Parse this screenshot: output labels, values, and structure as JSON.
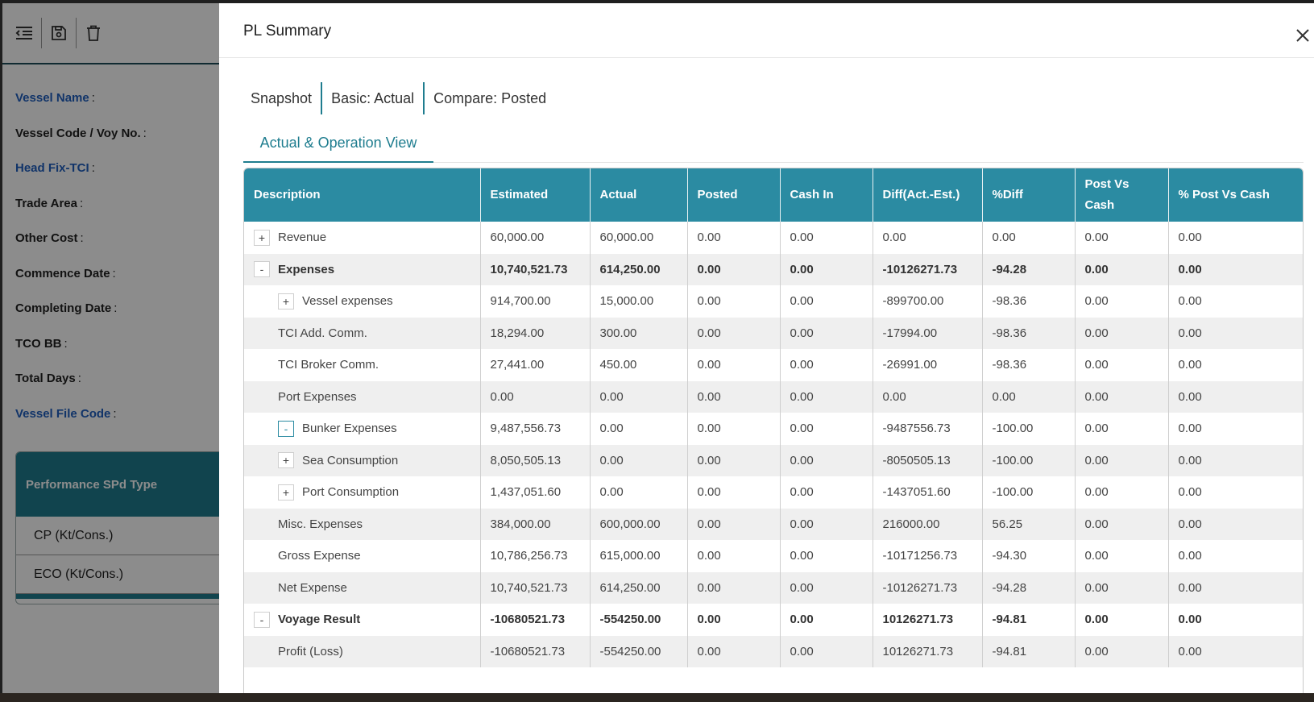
{
  "background": {
    "toolbar": {
      "icons": [
        "outdent-icon",
        "save-icon",
        "trash-icon"
      ]
    },
    "fields": [
      {
        "label": "Vessel Name",
        "highlight": true
      },
      {
        "label": "Vessel Code / Voy No.",
        "highlight": false
      },
      {
        "label": "Head Fix-TCI",
        "highlight": true
      },
      {
        "label": "Trade Area",
        "highlight": false
      },
      {
        "label": "Other Cost",
        "highlight": false
      },
      {
        "label": "Commence Date",
        "highlight": false
      },
      {
        "label": "Completing Date",
        "highlight": false
      },
      {
        "label": "TCO BB",
        "highlight": false
      },
      {
        "label": "Total Days",
        "highlight": false
      },
      {
        "label": "Vessel File Code",
        "highlight": true
      }
    ],
    "colon": ":",
    "performance": {
      "header": "Performance SPd Type",
      "rows": [
        "CP (Kt/Cons.)",
        "ECO (Kt/Cons.)"
      ]
    }
  },
  "drawer": {
    "title": "PL Summary",
    "close_icon": "close-icon",
    "snapshot_items": [
      "Snapshot",
      "Basic: Actual",
      "Compare: Posted"
    ],
    "tabs": [
      {
        "label": "Actual & Operation View",
        "active": true
      }
    ],
    "table": {
      "columns": [
        "Description",
        "Estimated",
        "Actual",
        "Posted",
        "Cash In",
        "Diff(Act.-Est.)",
        "%Diff",
        "Post Vs Cash",
        "% Post Vs Cash"
      ],
      "rows": [
        {
          "level": 0,
          "toggle": "+",
          "bold": false,
          "cells": [
            "Revenue",
            "60,000.00",
            "60,000.00",
            "0.00",
            "0.00",
            "0.00",
            "0.00",
            "0.00",
            "0.00"
          ]
        },
        {
          "level": 0,
          "toggle": "-",
          "bold": true,
          "cells": [
            "Expenses",
            "10,740,521.73",
            "614,250.00",
            "0.00",
            "0.00",
            "-10126271.73",
            "-94.28",
            "0.00",
            "0.00"
          ]
        },
        {
          "level": 1,
          "toggle": "+",
          "bold": false,
          "cells": [
            "Vessel expenses",
            "914,700.00",
            "15,000.00",
            "0.00",
            "0.00",
            "-899700.00",
            "-98.36",
            "0.00",
            "0.00"
          ]
        },
        {
          "level": 1,
          "toggle": "",
          "bold": false,
          "cells": [
            "TCI Add. Comm.",
            "18,294.00",
            "300.00",
            "0.00",
            "0.00",
            "-17994.00",
            "-98.36",
            "0.00",
            "0.00"
          ]
        },
        {
          "level": 1,
          "toggle": "",
          "bold": false,
          "cells": [
            "TCI Broker Comm.",
            "27,441.00",
            "450.00",
            "0.00",
            "0.00",
            "-26991.00",
            "-98.36",
            "0.00",
            "0.00"
          ]
        },
        {
          "level": 1,
          "toggle": "",
          "bold": false,
          "cells": [
            "Port Expenses",
            "0.00",
            "0.00",
            "0.00",
            "0.00",
            "0.00",
            "0.00",
            "0.00",
            "0.00"
          ]
        },
        {
          "level": 1,
          "toggle": "-",
          "active": true,
          "bold": false,
          "cells": [
            "Bunker Expenses",
            "9,487,556.73",
            "0.00",
            "0.00",
            "0.00",
            "-9487556.73",
            "-100.00",
            "0.00",
            "0.00"
          ]
        },
        {
          "level": 1,
          "toggle": "+",
          "bold": false,
          "cells": [
            "Sea Consumption",
            "8,050,505.13",
            "0.00",
            "0.00",
            "0.00",
            "-8050505.13",
            "-100.00",
            "0.00",
            "0.00"
          ]
        },
        {
          "level": 1,
          "toggle": "+",
          "bold": false,
          "cells": [
            "Port Consumption",
            "1,437,051.60",
            "0.00",
            "0.00",
            "0.00",
            "-1437051.60",
            "-100.00",
            "0.00",
            "0.00"
          ]
        },
        {
          "level": 1,
          "toggle": "",
          "bold": false,
          "cells": [
            "Misc. Expenses",
            "384,000.00",
            "600,000.00",
            "0.00",
            "0.00",
            "216000.00",
            "56.25",
            "0.00",
            "0.00"
          ]
        },
        {
          "level": 1,
          "toggle": "",
          "bold": false,
          "cells": [
            "Gross Expense",
            "10,786,256.73",
            "615,000.00",
            "0.00",
            "0.00",
            "-10171256.73",
            "-94.30",
            "0.00",
            "0.00"
          ]
        },
        {
          "level": 1,
          "toggle": "",
          "bold": false,
          "cells": [
            "Net Expense",
            "10,740,521.73",
            "614,250.00",
            "0.00",
            "0.00",
            "-10126271.73",
            "-94.28",
            "0.00",
            "0.00"
          ]
        },
        {
          "level": 0,
          "toggle": "-",
          "bold": true,
          "cells": [
            "Voyage Result",
            "-10680521.73",
            "-554250.00",
            "0.00",
            "0.00",
            "10126271.73",
            "-94.81",
            "0.00",
            "0.00"
          ]
        },
        {
          "level": 1,
          "toggle": "",
          "bold": false,
          "cells": [
            "Profit (Loss)",
            "-10680521.73",
            "-554250.00",
            "0.00",
            "0.00",
            "10126271.73",
            "-94.81",
            "0.00",
            "0.00"
          ]
        }
      ]
    }
  }
}
